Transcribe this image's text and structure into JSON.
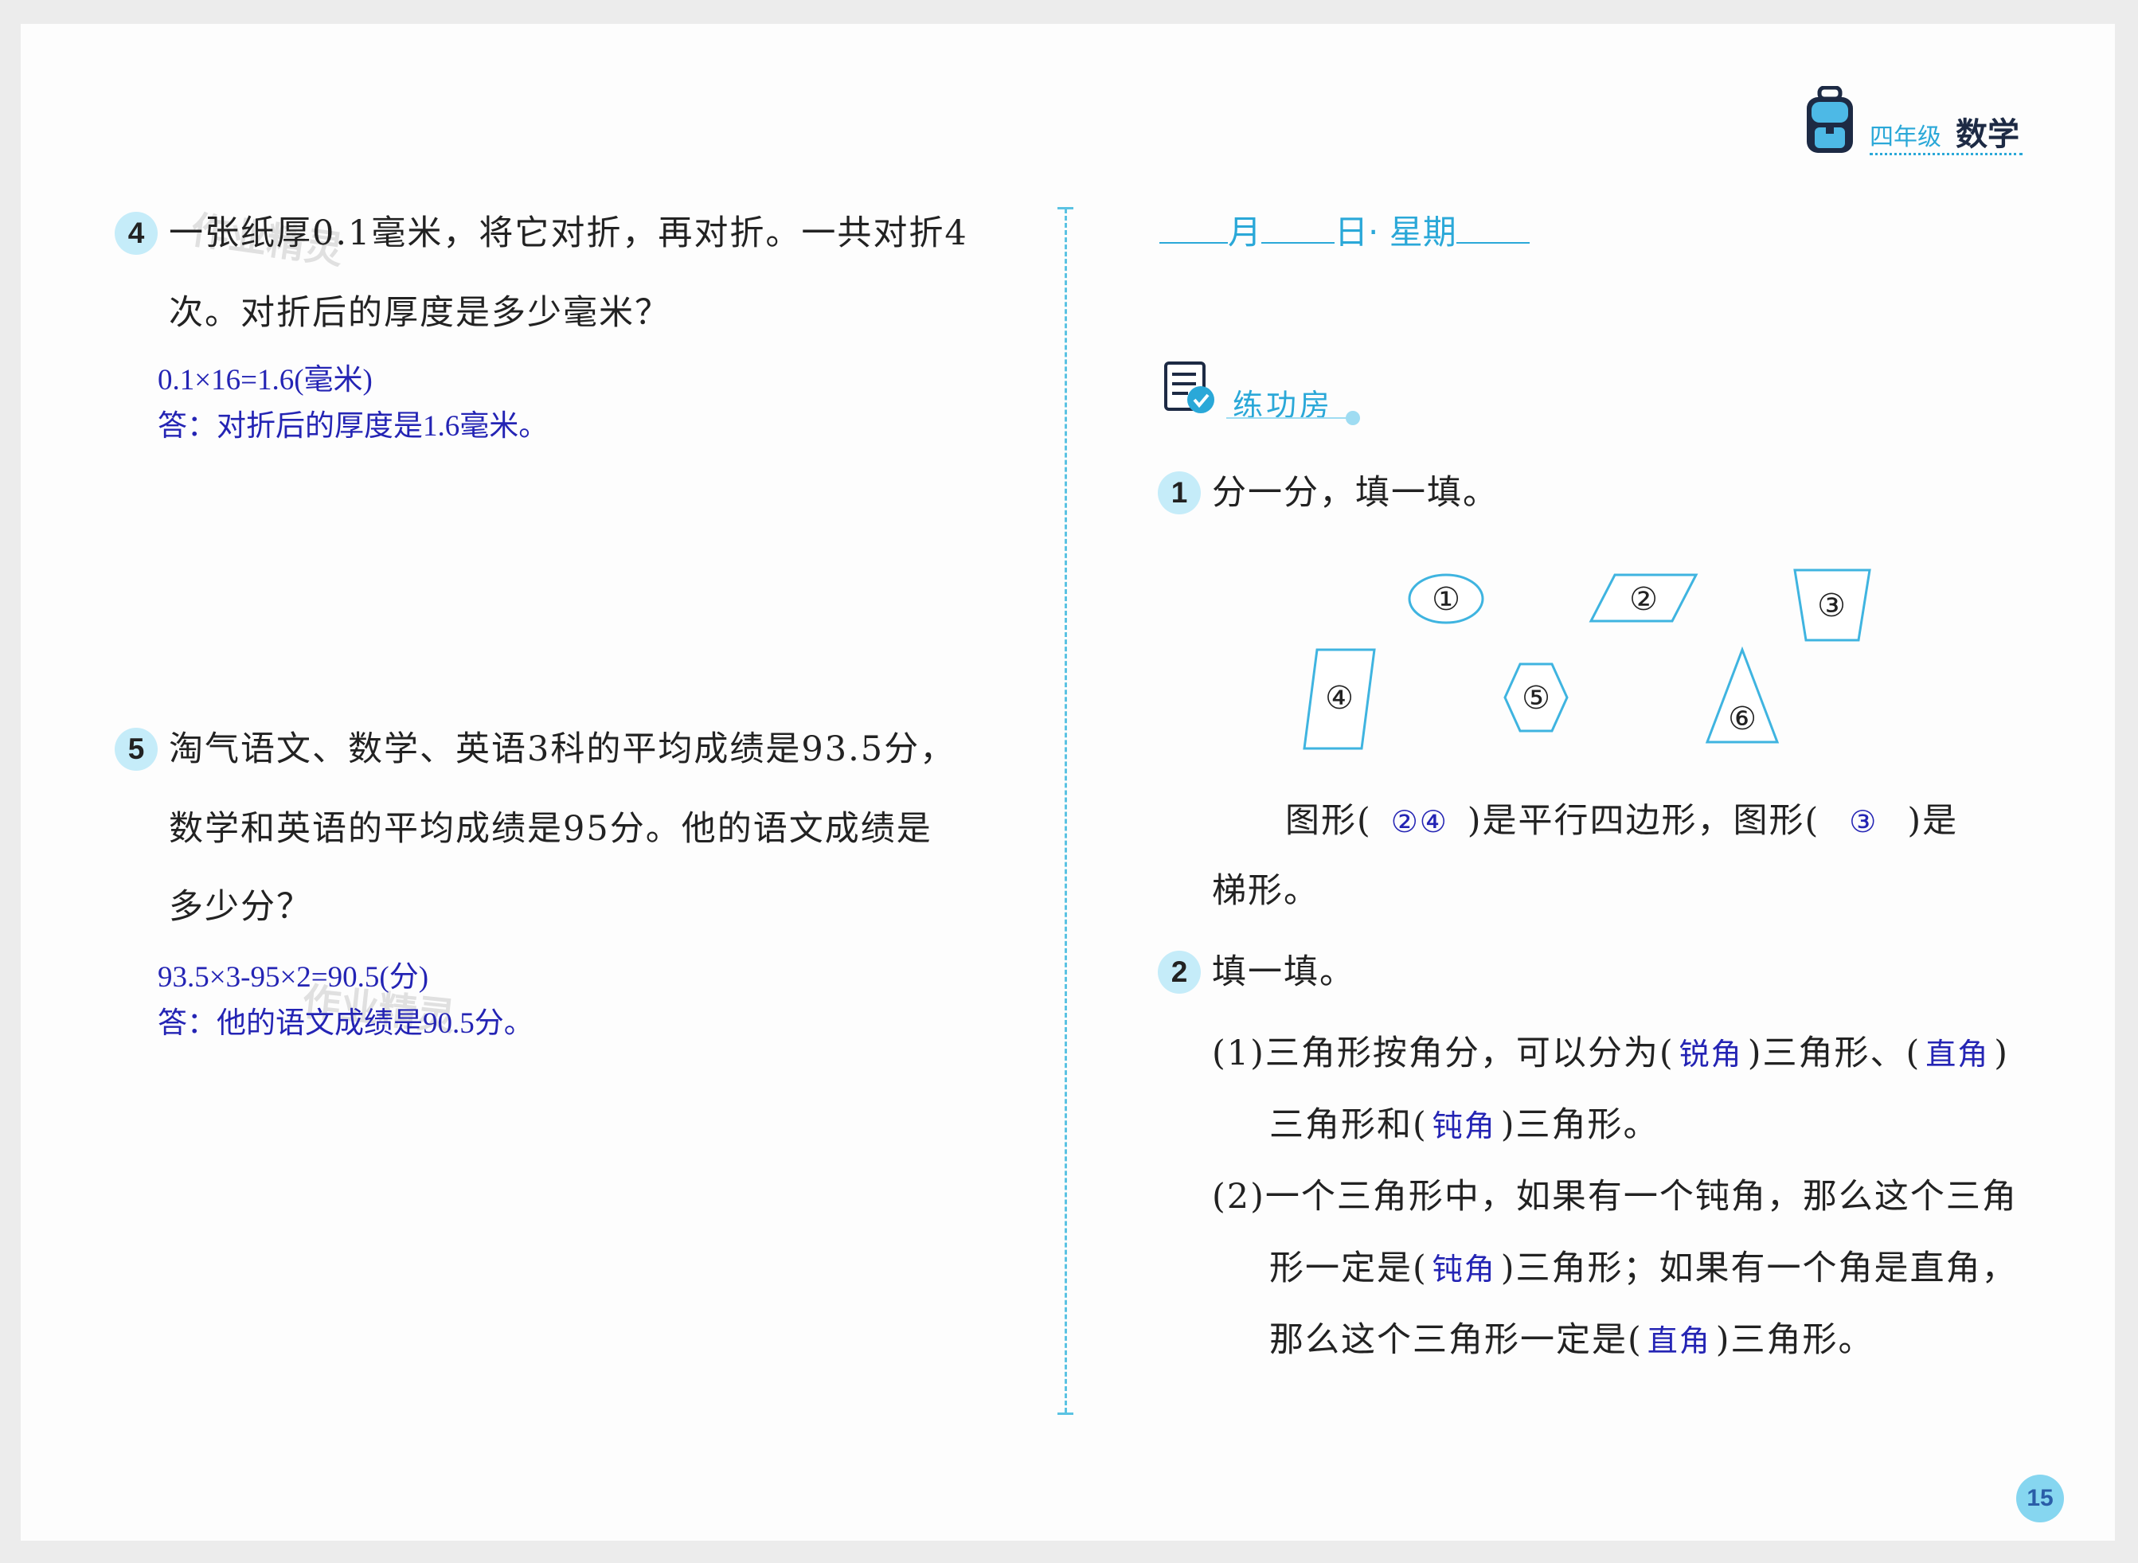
{
  "header": {
    "grade": "四年级",
    "subject": "数学"
  },
  "page_number": "15",
  "watermark": {
    "first": "作业精灵",
    "second": "作业精灵"
  },
  "left": {
    "q4": {
      "number": "4",
      "line1": "一张纸厚0.1毫米，将它对折，再对折。一共对折4",
      "line2": "次。对折后的厚度是多少毫米？",
      "answer1": "0.1×16=1.6(毫米)",
      "answer2": "答：对折后的厚度是1.6毫米。"
    },
    "q5": {
      "number": "5",
      "line1": "淘气语文、数学、英语3科的平均成绩是93.5分，",
      "line2": "数学和英语的平均成绩是95分。他的语文成绩是",
      "line3": "多少分？",
      "answer1": "93.5×3-95×2=90.5(分)",
      "answer2": "答：他的语文成绩是90.5分。"
    }
  },
  "right": {
    "date": {
      "month": "月",
      "day": "日",
      "weekday": "· 星期"
    },
    "section_title": "练功房",
    "q1": {
      "number": "1",
      "title": "分一分，填一填。",
      "shapes": [
        "①",
        "②",
        "③",
        "④",
        "⑤",
        "⑥"
      ],
      "text_a": "图形(",
      "fill_a": "②④",
      "text_b": ")是平行四边形，图形(",
      "fill_b": "③",
      "text_c": ")是",
      "text_d": "梯形。"
    },
    "q2": {
      "number": "2",
      "title": "填一填。",
      "p1_a": "(1)三角形按角分，可以分为(",
      "p1_fill1": "锐角",
      "p1_b": ")三角形、(",
      "p1_fill2": "直角",
      "p1_c": ")",
      "p1_d": "三角形和(",
      "p1_fill3": "钝角",
      "p1_e": ")三角形。",
      "p2_a": "(2)一个三角形中，如果有一个钝角，那么这个三角",
      "p2_b": "形一定是(",
      "p2_fill1": "钝角",
      "p2_c": ")三角形；如果有一个角是直角，",
      "p2_d": "那么这个三角形一定是(",
      "p2_fill2": "直角",
      "p2_e": ")三角形。"
    }
  },
  "colors": {
    "accent": "#2aa8d8",
    "answer": "#2424b4",
    "badge_bg": "#c5ecf9"
  }
}
